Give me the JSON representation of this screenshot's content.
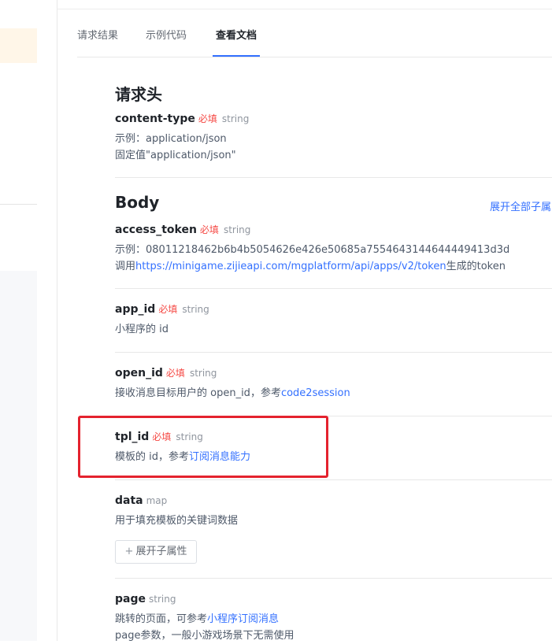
{
  "tabs": [
    {
      "label": "请求结果",
      "active": false
    },
    {
      "label": "示例代码",
      "active": false
    },
    {
      "label": "查看文档",
      "active": true
    }
  ],
  "headers_section": {
    "title": "请求头",
    "fields": [
      {
        "name": "content-type",
        "required": "必填",
        "type": "string",
        "example": "示例：application/json",
        "fixed": "固定值\"application/json\""
      }
    ]
  },
  "body_section": {
    "title": "Body",
    "expand_all_label": "展开全部子属",
    "access_token": {
      "name": "access_token",
      "required": "必填",
      "type": "string",
      "example": "示例：08011218462b6b4b5054626e426e50685a7554643144644449413d3d",
      "desc_prefix": "调用",
      "desc_link": "https://minigame.zijieapi.com/mgplatform/api/apps/v2/token",
      "desc_suffix": "生成的token"
    },
    "app_id": {
      "name": "app_id",
      "required": "必填",
      "type": "string",
      "desc": "小程序的 id"
    },
    "open_id": {
      "name": "open_id",
      "required": "必填",
      "type": "string",
      "desc_prefix": "接收消息目标用户的 open_id，参考",
      "desc_link": "code2session"
    },
    "tpl_id": {
      "name": "tpl_id",
      "required": "必填",
      "type": "string",
      "desc_prefix": "模板的 id，参考",
      "desc_link": "订阅消息能力"
    },
    "data": {
      "name": "data",
      "type": "map",
      "desc": "用于填充模板的关键词数据",
      "expand_label": "展开子属性",
      "expand_icon": "+"
    },
    "page": {
      "name": "page",
      "type": "string",
      "desc_prefix": "跳转的页面，可参考",
      "desc_link": "小程序订阅消息",
      "desc2": "page参数，一般小游戏场景下无需使用"
    }
  },
  "colors": {
    "accent": "#3370ff",
    "required": "#f54a45",
    "highlight_box": "#e4222e"
  }
}
